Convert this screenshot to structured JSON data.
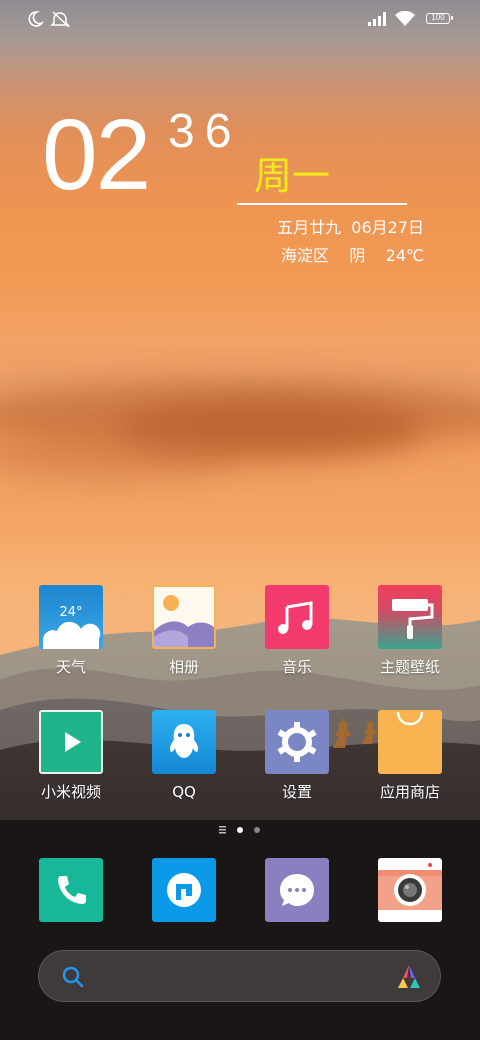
{
  "status_bar": {
    "battery": "100",
    "icons": [
      "moon-icon",
      "mute-icon",
      "signal-icon",
      "wifi-icon",
      "battery-icon"
    ]
  },
  "clock": {
    "hour": "02",
    "minute": "36",
    "weekday": "周一",
    "date": "五月廿九  06月27日",
    "weather": "海淀区    阴    24℃"
  },
  "apps": [
    {
      "label": "天气",
      "icon": "weather-icon",
      "temp": "24°"
    },
    {
      "label": "相册",
      "icon": "gallery-icon"
    },
    {
      "label": "音乐",
      "icon": "music-icon"
    },
    {
      "label": "主题壁纸",
      "icon": "themes-icon"
    },
    {
      "label": "小米视频",
      "icon": "video-icon"
    },
    {
      "label": "QQ",
      "icon": "qq-icon"
    },
    {
      "label": "设置",
      "icon": "settings-icon"
    },
    {
      "label": "应用商店",
      "icon": "app-store-icon"
    }
  ],
  "dock": [
    {
      "icon": "phone-icon"
    },
    {
      "icon": "browser-icon"
    },
    {
      "icon": "messages-icon"
    },
    {
      "icon": "camera-icon"
    }
  ],
  "page_indicator": {
    "pages": 2,
    "current": 0
  },
  "search": {
    "placeholder": ""
  },
  "colors": {
    "weekday": "#f3ea1a",
    "weather_tile": "#1f8fd0",
    "music_tile": "#f23a6d",
    "video_tile": "#1fb48a",
    "qq_tile": "#1a9be6",
    "settings_tile": "#7b86c4",
    "store_tile": "#f7b450",
    "phone_tile": "#17b79a",
    "browser_tile": "#0a9ae8",
    "messages_tile": "#8a7fc0"
  }
}
